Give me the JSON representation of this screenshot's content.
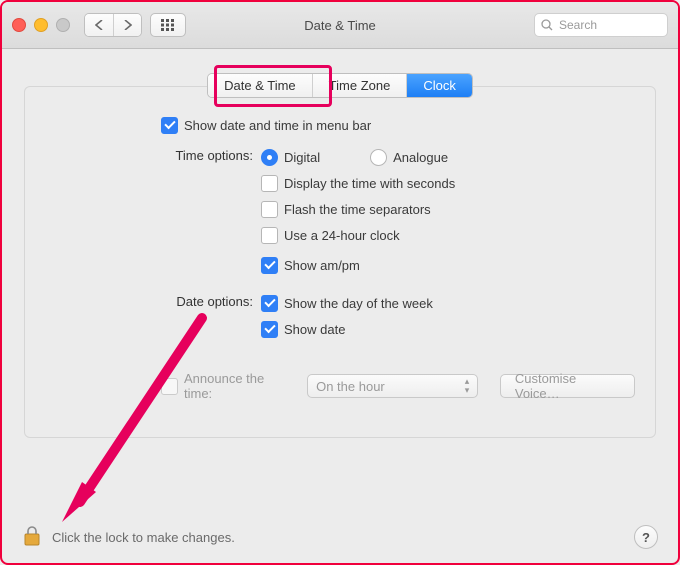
{
  "window_title": "Date & Time",
  "toolbar": {
    "search_placeholder": "Search"
  },
  "tabs": {
    "date_time": "Date & Time",
    "time_zone": "Time Zone",
    "clock": "Clock",
    "active": "clock"
  },
  "options": {
    "show_menubar": {
      "label": "Show date and time in menu bar",
      "checked": true
    },
    "time_label": "Time options:",
    "digital": {
      "label": "Digital",
      "checked": true
    },
    "analogue": {
      "label": "Analogue",
      "checked": false
    },
    "seconds": {
      "label": "Display the time with seconds",
      "checked": false
    },
    "flash": {
      "label": "Flash the time separators",
      "checked": false
    },
    "h24": {
      "label": "Use a 24-hour clock",
      "checked": false
    },
    "ampm": {
      "label": "Show am/pm",
      "checked": true
    },
    "date_label": "Date options:",
    "dow": {
      "label": "Show the day of the week",
      "checked": true
    },
    "showdate": {
      "label": "Show date",
      "checked": true
    },
    "announce": {
      "label": "Announce the time:",
      "checked": false
    },
    "interval_value": "On the hour",
    "customise_label": "Customise Voice…"
  },
  "footer": {
    "lock_text": "Click the lock to make changes.",
    "help_label": "?"
  }
}
